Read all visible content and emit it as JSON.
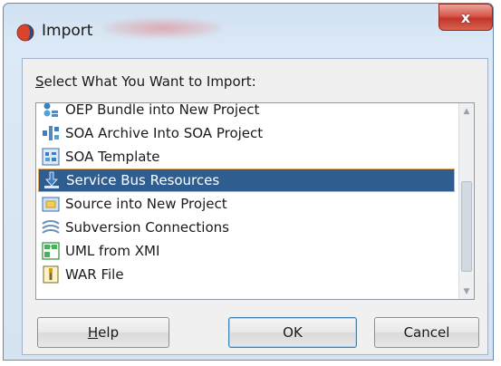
{
  "window": {
    "title": "Import",
    "close_label": "x"
  },
  "dialog": {
    "prompt_label": "Select What You Want to Import:",
    "prompt_mnemonic": "S",
    "prompt_rest": "elect What You Want to Import:"
  },
  "list": {
    "items": [
      {
        "label": "OEP Bundle into New Project",
        "icon": "oep-bundle-icon",
        "selected": false
      },
      {
        "label": "SOA Archive Into SOA Project",
        "icon": "soa-archive-icon",
        "selected": false
      },
      {
        "label": "SOA Template",
        "icon": "soa-template-icon",
        "selected": false
      },
      {
        "label": "Service Bus Resources",
        "icon": "service-bus-icon",
        "selected": true
      },
      {
        "label": "Source into New Project",
        "icon": "source-folder-icon",
        "selected": false
      },
      {
        "label": "Subversion Connections",
        "icon": "subversion-icon",
        "selected": false
      },
      {
        "label": "UML from XMI",
        "icon": "uml-icon",
        "selected": false
      },
      {
        "label": "WAR File",
        "icon": "war-file-icon",
        "selected": false
      }
    ]
  },
  "buttons": {
    "help": "Help",
    "help_mnemonic": "H",
    "help_rest": "elp",
    "ok": "OK",
    "cancel": "Cancel"
  }
}
